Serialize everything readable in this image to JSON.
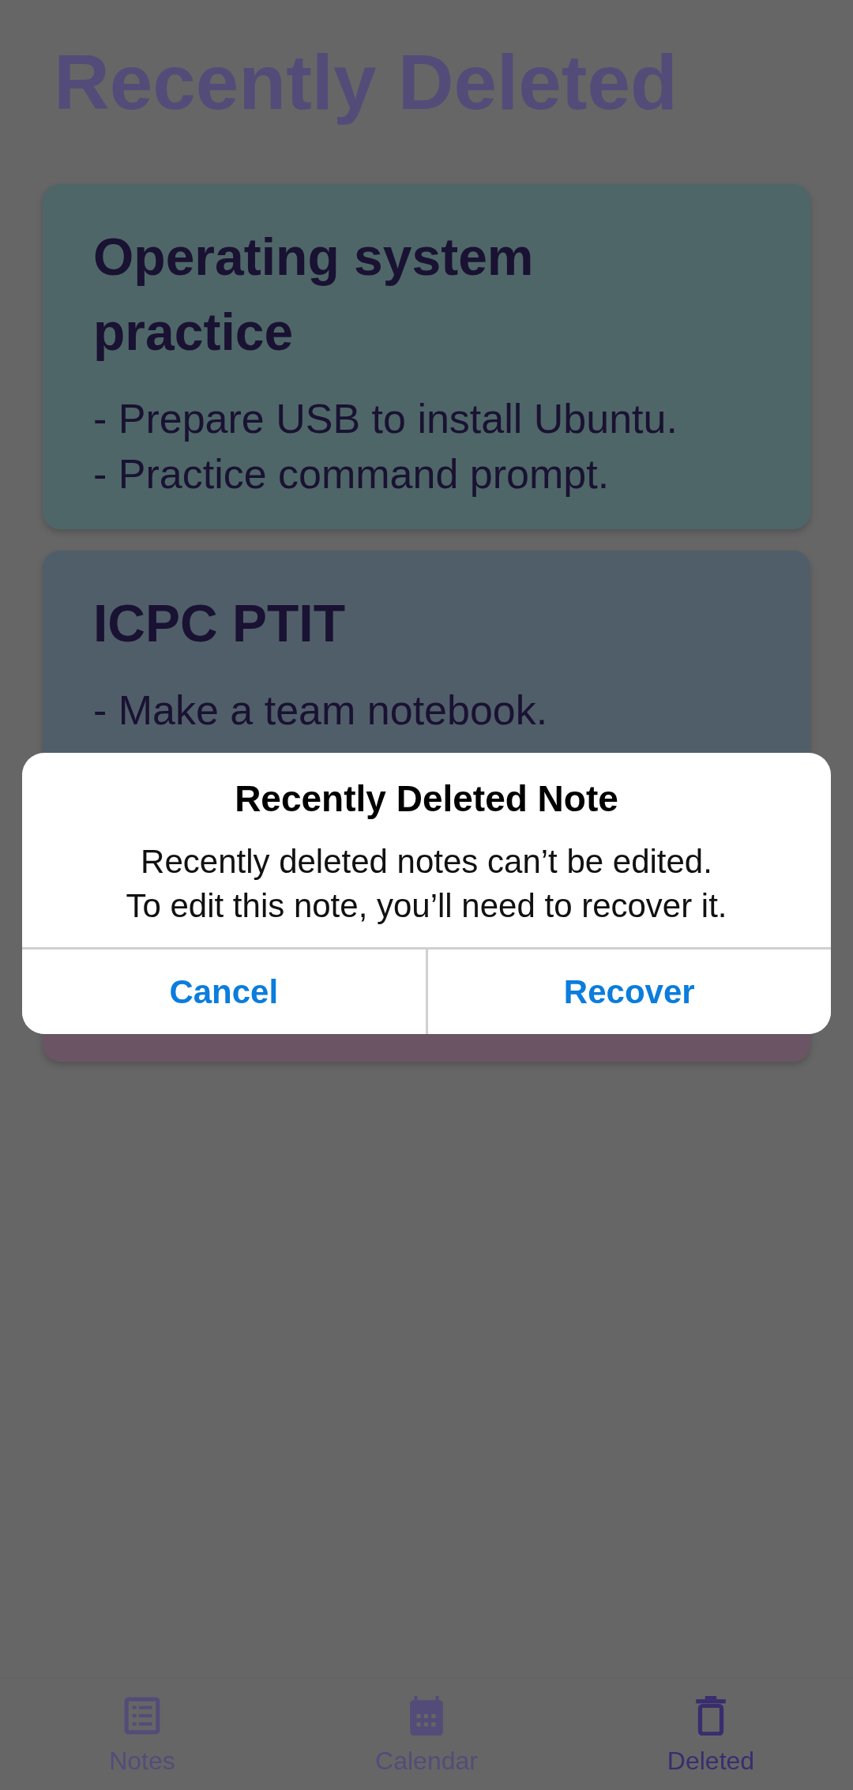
{
  "screen": {
    "title": "Recently Deleted"
  },
  "notes": [
    {
      "title": "Operating system practice",
      "lines": [
        "- Prepare USB to install Ubuntu.",
        "- Practice command prompt."
      ],
      "color": "#4e6668"
    },
    {
      "title": "ICPC PTIT",
      "lines": [
        "- Make a team notebook."
      ],
      "color": "#505e69"
    },
    {
      "color": "#6b5565"
    }
  ],
  "dialog": {
    "title": "Recently Deleted Note",
    "message": [
      "Recently deleted notes can’t be edited.",
      "To edit this note, you’ll need to recover it."
    ],
    "buttons": [
      "Cancel",
      "Recover"
    ]
  },
  "nav": [
    {
      "label": "Notes",
      "selected": false
    },
    {
      "label": "Calendar",
      "selected": false
    },
    {
      "label": "Deleted",
      "selected": true
    }
  ]
}
